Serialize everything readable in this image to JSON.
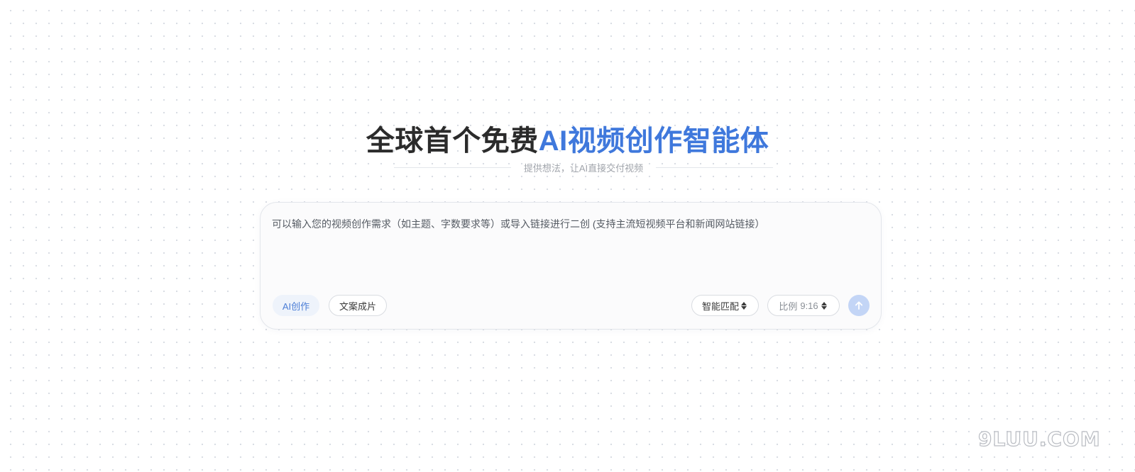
{
  "hero": {
    "title_main": "全球首个免费",
    "title_accent": "AI视频创作智能体",
    "subtitle": "提供想法，让AI直接交付视频"
  },
  "composer": {
    "placeholder": "可以输入您的视频创作需求（如主题、字数要求等）或导入链接进行二创 (支持主流短视频平台和新闻网站链接）",
    "modes": {
      "ai_creation": "AI创作",
      "copy_to_video": "文案成片"
    },
    "match_select": {
      "value": "智能匹配",
      "icon": "sort-icon"
    },
    "ratio_select": {
      "label": "比例",
      "value": "9:16",
      "icon": "sort-icon"
    },
    "send": {
      "icon": "arrow-up-icon"
    }
  },
  "watermark": {
    "text": "9LUU.COM"
  },
  "colors": {
    "accent": "#3f78dc",
    "title_dark": "#2b2b2b",
    "send_button": "#c3d5f6",
    "mode_active_bg": "#eef3fb"
  }
}
